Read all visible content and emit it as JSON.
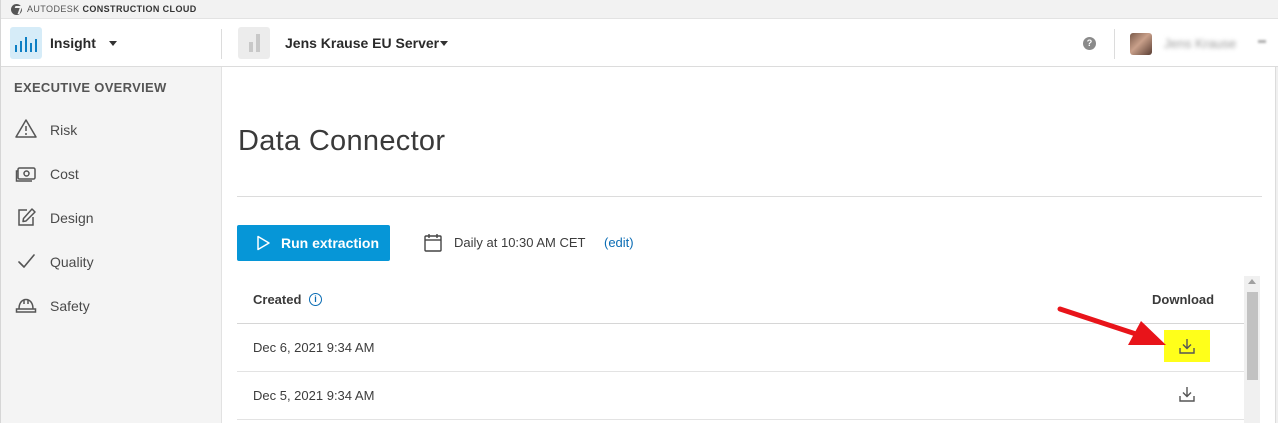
{
  "brand": {
    "prefix": "AUTODESK",
    "name": "CONSTRUCTION CLOUD"
  },
  "header": {
    "app_name": "Insight",
    "project_name": "Jens Krause EU Server",
    "help": "?",
    "user_name": "Jens Krause"
  },
  "sidebar": {
    "heading": "EXECUTIVE OVERVIEW",
    "items": [
      {
        "label": "Risk",
        "icon": "warning-icon"
      },
      {
        "label": "Cost",
        "icon": "money-icon"
      },
      {
        "label": "Design",
        "icon": "edit-icon"
      },
      {
        "label": "Quality",
        "icon": "checkmark-icon"
      },
      {
        "label": "Safety",
        "icon": "hardhat-icon"
      }
    ]
  },
  "main": {
    "title": "Data Connector",
    "run_button": "Run extraction",
    "schedule": "Daily at 10:30 AM CET",
    "edit_link": "(edit)",
    "table": {
      "headers": {
        "created": "Created",
        "download": "Download"
      },
      "info": "i",
      "rows": [
        {
          "created": "Dec 6, 2021 9:34 AM",
          "highlighted": true
        },
        {
          "created": "Dec 5, 2021 9:34 AM",
          "highlighted": false
        }
      ]
    }
  },
  "colors": {
    "accent": "#0696d7",
    "link": "#0a6cb4",
    "highlight": "#ffff1a",
    "annotation_arrow": "#e8141a"
  }
}
